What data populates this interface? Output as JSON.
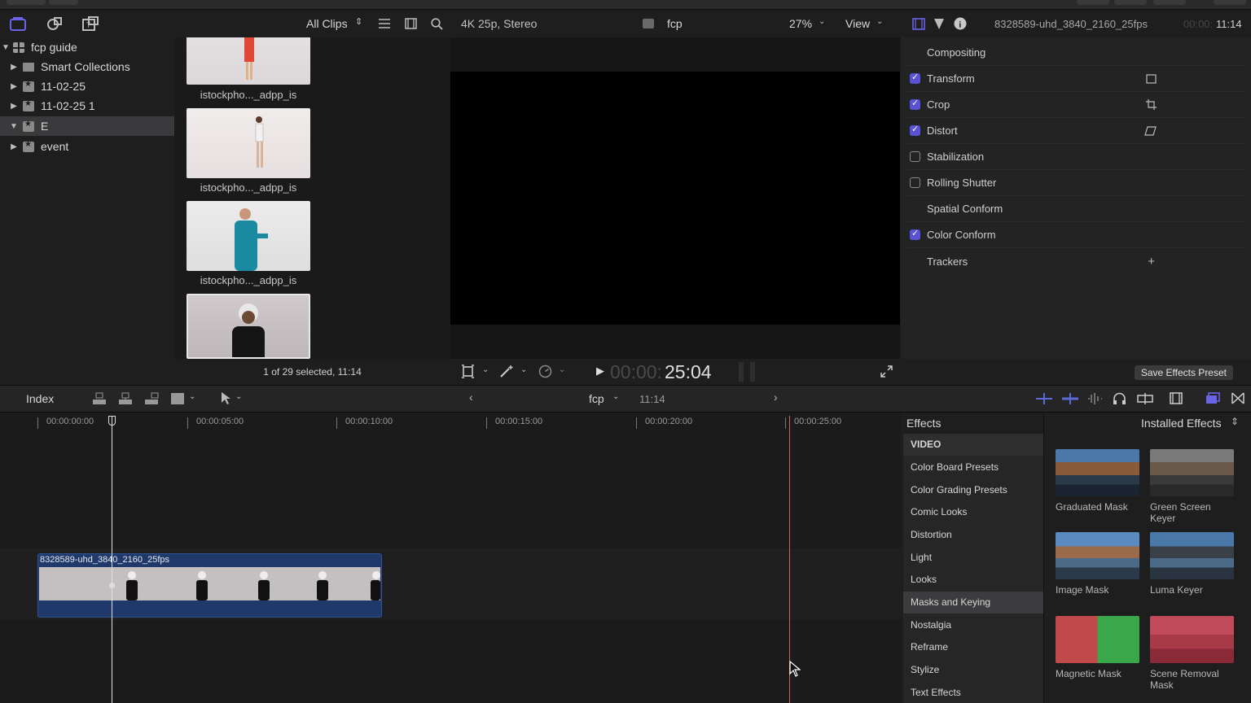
{
  "library": {
    "root": "fcp guide",
    "items": [
      {
        "label": "Smart Collections",
        "icon": "folder-icon"
      },
      {
        "label": "11-02-25",
        "icon": "event-star-icon"
      },
      {
        "label": "11-02-25 1",
        "icon": "event-star-icon"
      },
      {
        "label": "E",
        "icon": "event-star-icon",
        "selected": true
      },
      {
        "label": "event",
        "icon": "event-star-icon"
      }
    ]
  },
  "browser": {
    "filter_label": "All Clips",
    "clips": [
      {
        "label": "istockpho..._adpp_is"
      },
      {
        "label": "istockpho..._adpp_is"
      },
      {
        "label": "istockpho..._adpp_is"
      },
      {
        "label": ""
      }
    ],
    "status": "1 of 29 selected, 11:14"
  },
  "viewer": {
    "format": "4K 25p, Stereo",
    "project": "fcp",
    "zoom": "27%",
    "view_label": "View",
    "timecode_dim": "00:00:",
    "timecode": "25:04"
  },
  "inspector": {
    "clip_name": "8328589-uhd_3840_2160_25fps",
    "duration_dim": "00:00:",
    "duration": "11:14",
    "rows": [
      {
        "label": "Compositing",
        "check": "none",
        "icon": ""
      },
      {
        "label": "Transform",
        "check": "on",
        "icon": "transform-icon"
      },
      {
        "label": "Crop",
        "check": "on",
        "icon": "crop-icon"
      },
      {
        "label": "Distort",
        "check": "on",
        "icon": "distort-icon"
      },
      {
        "label": "Stabilization",
        "check": "off",
        "icon": ""
      },
      {
        "label": "Rolling Shutter",
        "check": "off",
        "icon": ""
      },
      {
        "label": "Spatial Conform",
        "check": "none",
        "icon": ""
      },
      {
        "label": "Color Conform",
        "check": "on",
        "icon": ""
      },
      {
        "label": "Trackers",
        "check": "none",
        "icon": "plus-icon"
      }
    ],
    "save_preset": "Save Effects Preset"
  },
  "timeline": {
    "index_label": "Index",
    "project": "fcp",
    "duration": "11:14",
    "ruler": [
      "00:00:00:00",
      "00:00:05:00",
      "00:00:10:00",
      "00:00:15:00",
      "00:00:20:00",
      "00:00:25:00"
    ],
    "clip_name": "8328589-uhd_3840_2160_25fps"
  },
  "effects": {
    "title": "Effects",
    "source": "Installed Effects",
    "categories": [
      "VIDEO",
      "Color Board Presets",
      "Color Grading Presets",
      "Comic Looks",
      "Distortion",
      "Light",
      "Looks",
      "Masks and Keying",
      "Nostalgia",
      "Reframe",
      "Stylize",
      "Text Effects"
    ],
    "selected_category": "Masks and Keying",
    "tiles": [
      {
        "name": "Graduated Mask"
      },
      {
        "name": "Green Screen Keyer"
      },
      {
        "name": "Image Mask"
      },
      {
        "name": "Luma Keyer"
      },
      {
        "name": "Magnetic Mask"
      },
      {
        "name": "Scene Removal Mask"
      }
    ]
  },
  "colors": {
    "accent": "#5a52d6",
    "skimmer": "#d0683e",
    "clip": "#1f3a6a"
  }
}
